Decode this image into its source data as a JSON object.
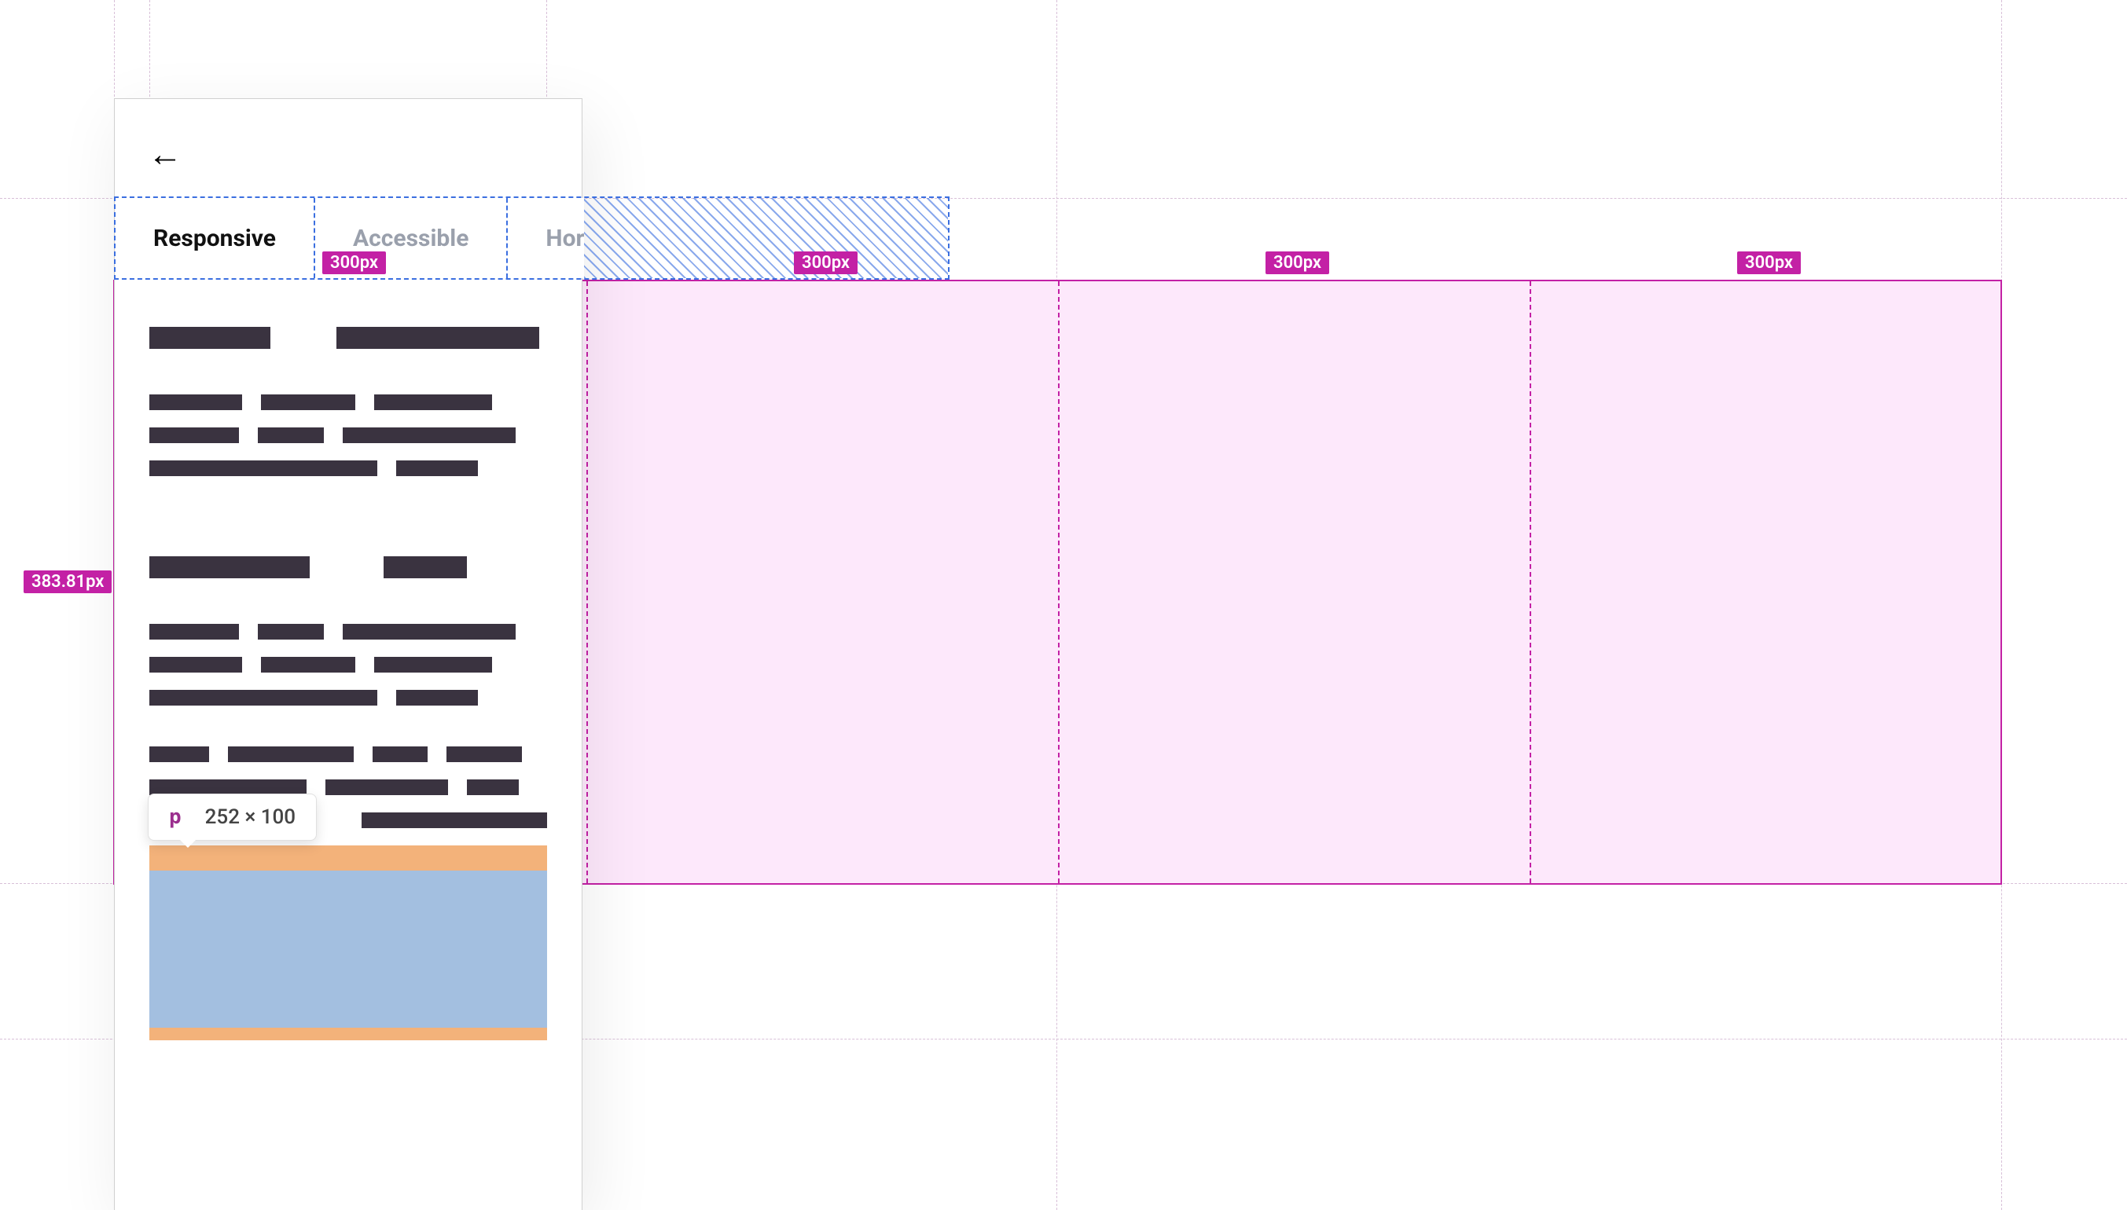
{
  "tabs": {
    "items": [
      {
        "label": "Responsive",
        "active": true
      },
      {
        "label": "Accessible",
        "active": false
      },
      {
        "label": "Horizontal",
        "active": false
      }
    ]
  },
  "grid": {
    "column_labels": [
      "300px",
      "300px",
      "300px",
      "300px"
    ],
    "row_height_label": "383.81px"
  },
  "tooltip": {
    "tag": "p",
    "dimensions": "252 × 100"
  },
  "icons": {
    "back": "←"
  }
}
